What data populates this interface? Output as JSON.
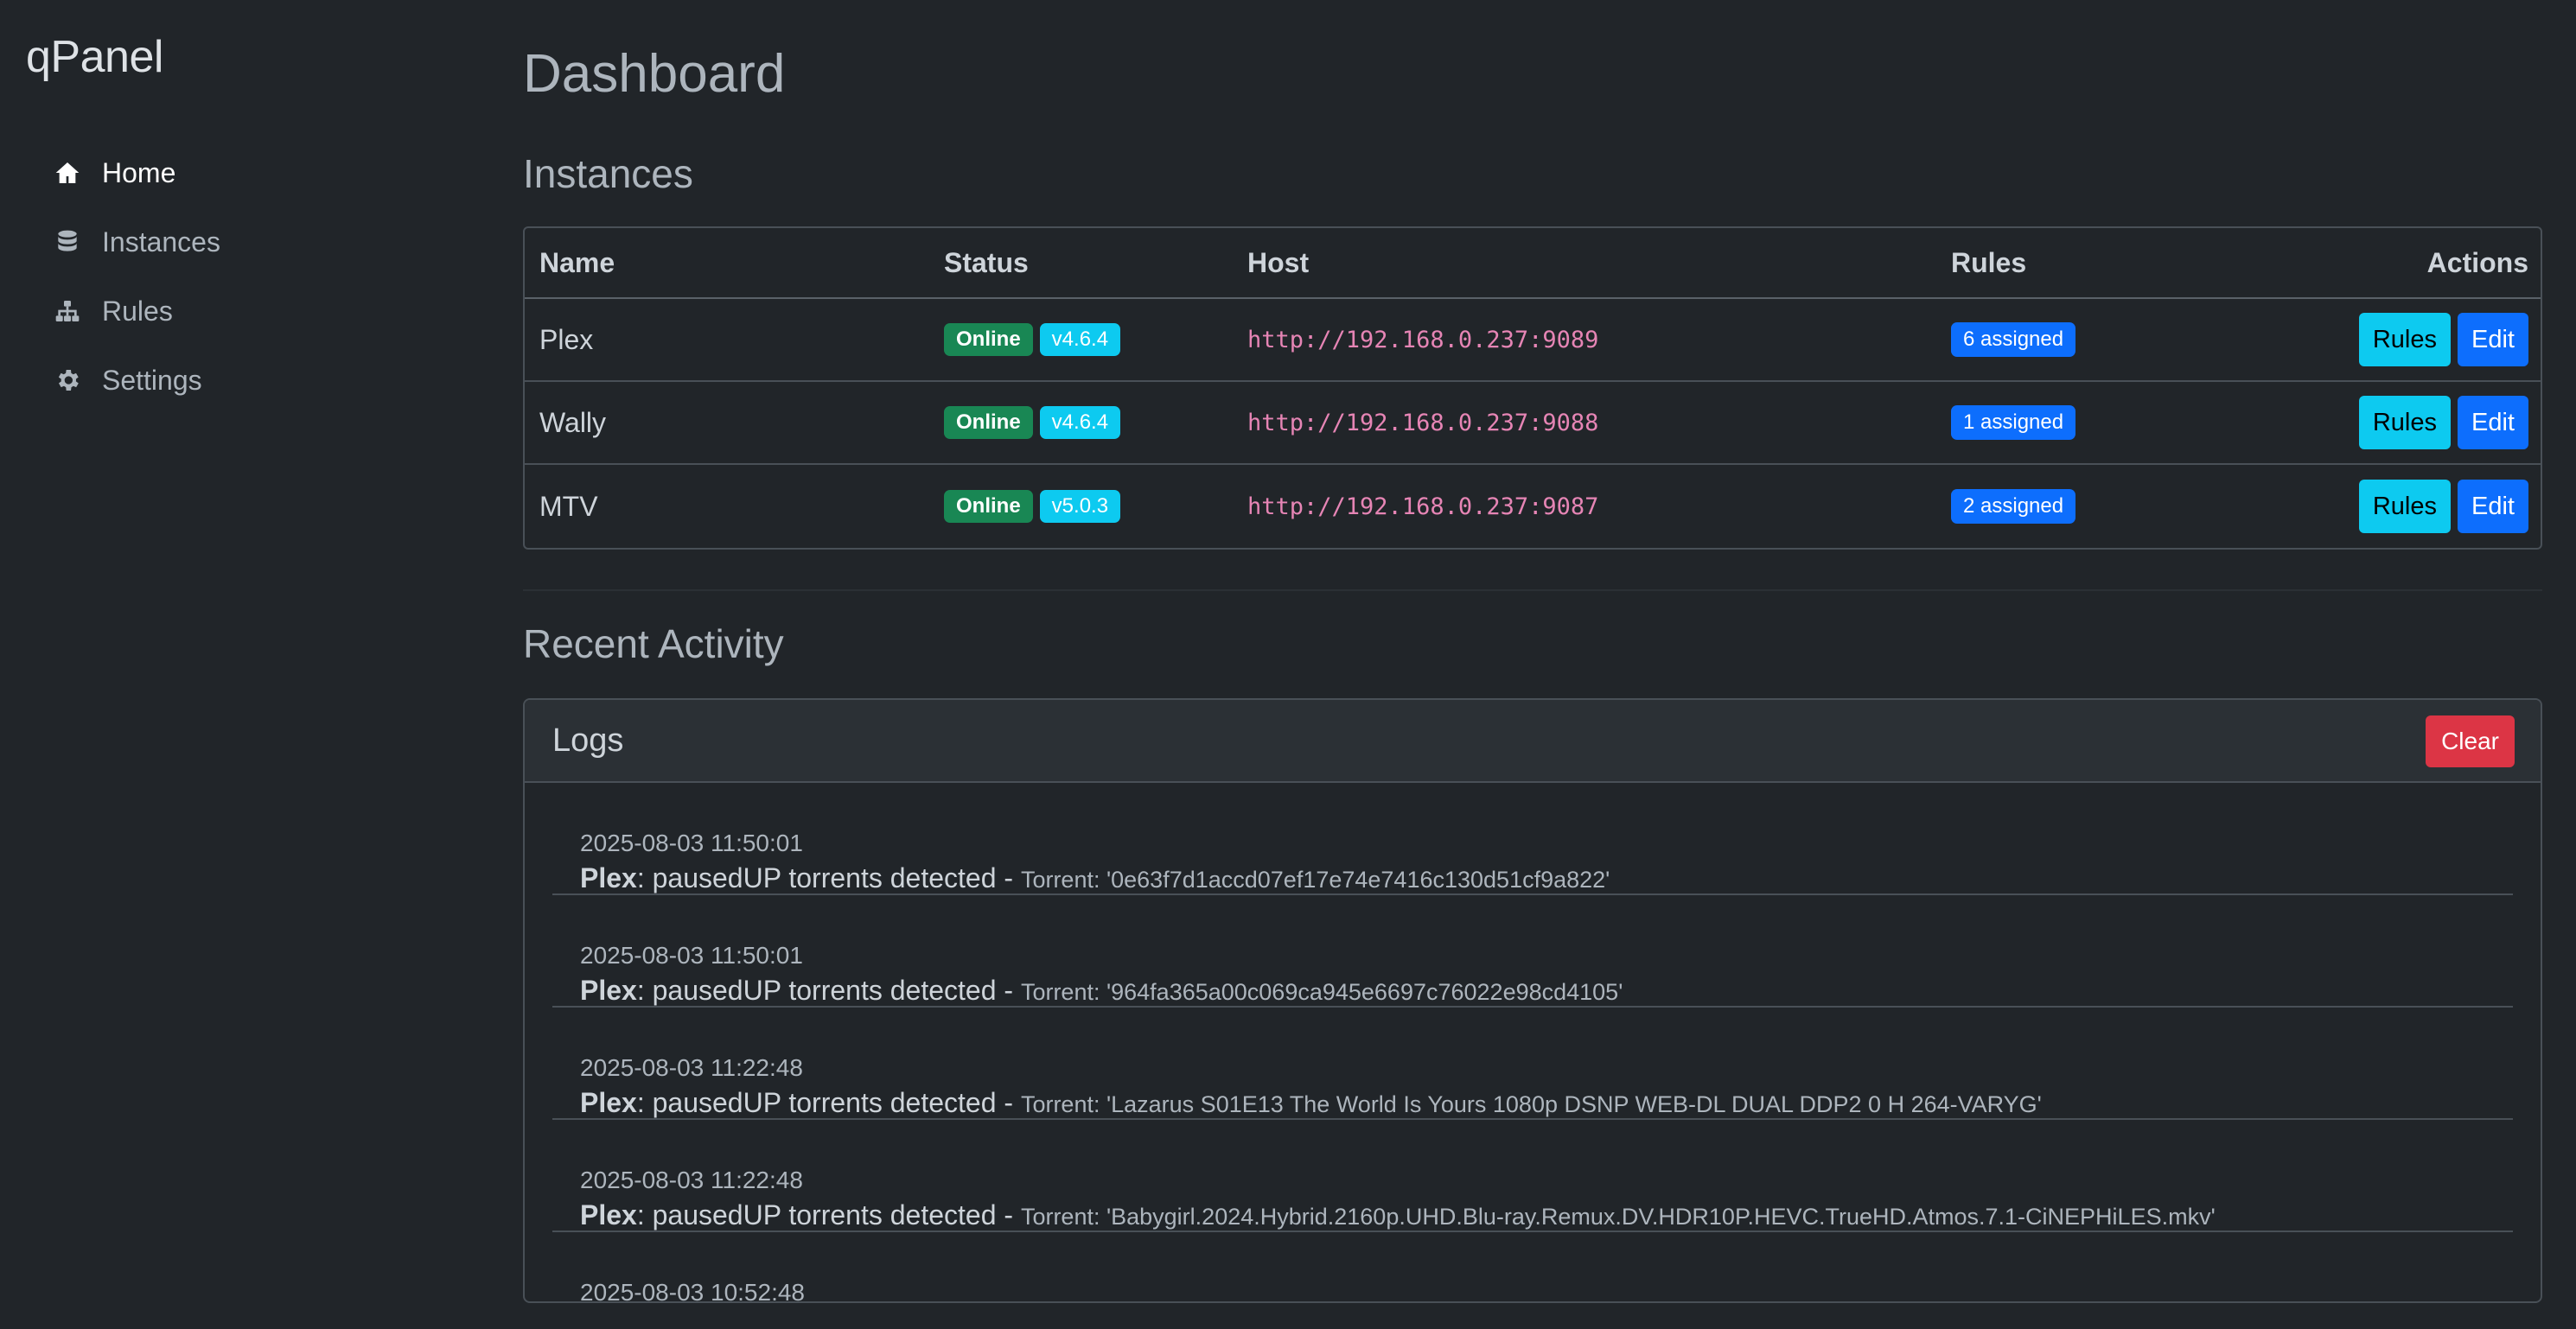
{
  "brand": "qPanel",
  "nav": [
    {
      "label": "Home",
      "icon": "home-icon",
      "active": true
    },
    {
      "label": "Instances",
      "icon": "database-icon",
      "active": false
    },
    {
      "label": "Rules",
      "icon": "sitemap-icon",
      "active": false
    },
    {
      "label": "Settings",
      "icon": "gear-icon",
      "active": false
    }
  ],
  "page_title": "Dashboard",
  "instances": {
    "title": "Instances",
    "columns": [
      "Name",
      "Status",
      "Host",
      "Rules",
      "Actions"
    ],
    "rows": [
      {
        "name": "Plex",
        "status": "Online",
        "version": "v4.6.4",
        "host": "http://192.168.0.237:9089",
        "rules": "6 assigned",
        "btn_rules": "Rules",
        "btn_edit": "Edit"
      },
      {
        "name": "Wally",
        "status": "Online",
        "version": "v4.6.4",
        "host": "http://192.168.0.237:9088",
        "rules": "1 assigned",
        "btn_rules": "Rules",
        "btn_edit": "Edit"
      },
      {
        "name": "MTV",
        "status": "Online",
        "version": "v5.0.3",
        "host": "http://192.168.0.237:9087",
        "rules": "2 assigned",
        "btn_rules": "Rules",
        "btn_edit": "Edit"
      }
    ]
  },
  "activity": {
    "title": "Recent Activity",
    "card_title": "Logs",
    "clear_label": "Clear",
    "logs": [
      {
        "ts": "2025-08-03 11:50:01",
        "instance": "Plex",
        "message": ": pausedUP torrents detected - ",
        "detail": "Torrent: '0e63f7d1accd07ef17e74e7416c130d51cf9a822'"
      },
      {
        "ts": "2025-08-03 11:50:01",
        "instance": "Plex",
        "message": ": pausedUP torrents detected - ",
        "detail": "Torrent: '964fa365a00c069ca945e6697c76022e98cd4105'"
      },
      {
        "ts": "2025-08-03 11:22:48",
        "instance": "Plex",
        "message": ": pausedUP torrents detected - ",
        "detail": "Torrent: 'Lazarus S01E13 The World Is Yours 1080p DSNP WEB-DL DUAL DDP2 0 H 264-VARYG'"
      },
      {
        "ts": "2025-08-03 11:22:48",
        "instance": "Plex",
        "message": ": pausedUP torrents detected - ",
        "detail": "Torrent: 'Babygirl.2024.Hybrid.2160p.UHD.Blu-ray.Remux.DV.HDR10P.HEVC.TrueHD.Atmos.7.1-CiNEPHiLES.mkv'"
      },
      {
        "ts": "2025-08-03 10:52:48",
        "instance": "",
        "message": "",
        "detail": ""
      }
    ]
  },
  "colors": {
    "background": "#212529",
    "online": "#198754",
    "version": "#0dcaf0",
    "primary": "#0d6efd",
    "danger": "#dc3545",
    "host_text": "#e685b5"
  }
}
